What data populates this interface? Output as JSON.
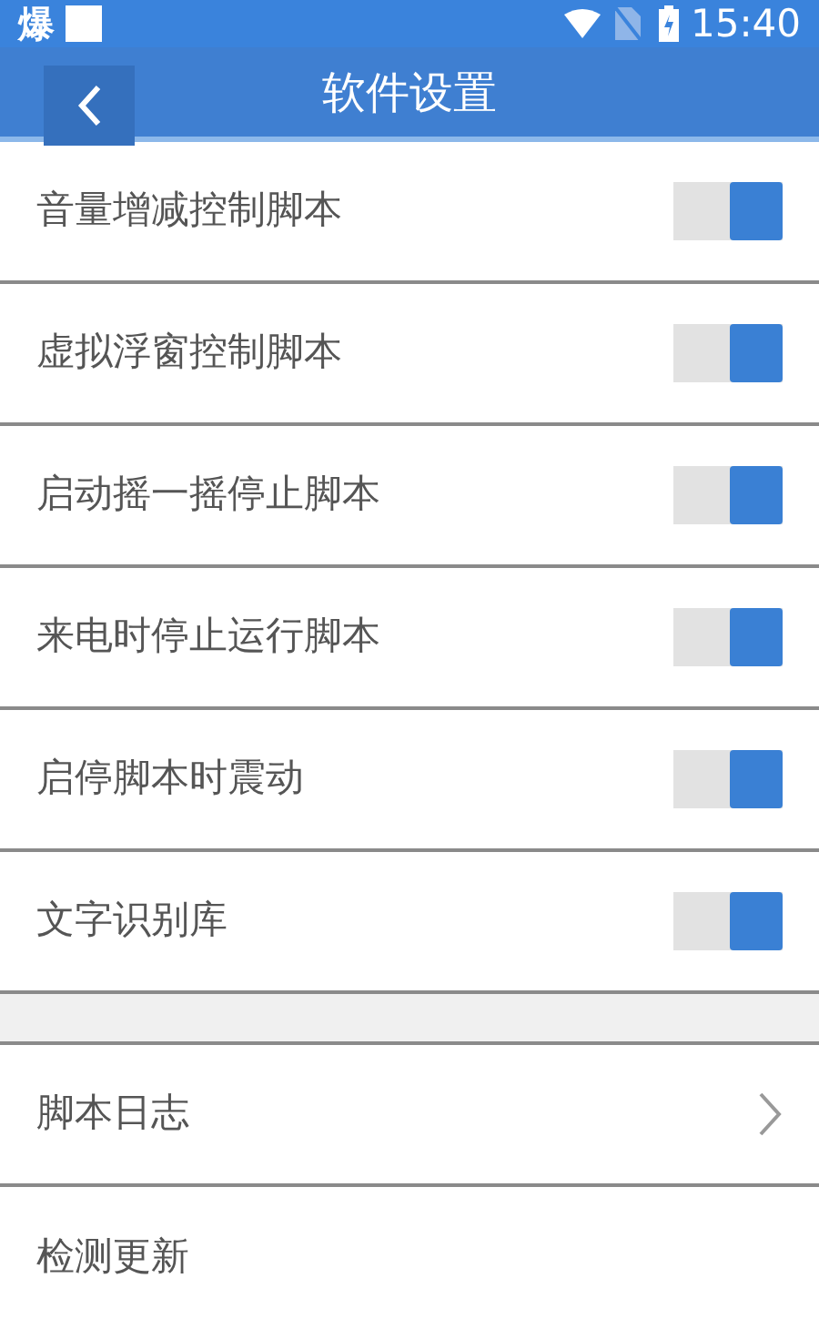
{
  "status_bar": {
    "app_glyph": "爆",
    "time": "15:40"
  },
  "header": {
    "title": "软件设置"
  },
  "toggles": [
    {
      "label": "音量增减控制脚本",
      "on": true
    },
    {
      "label": "虚拟浮窗控制脚本",
      "on": true
    },
    {
      "label": "启动摇一摇停止脚本",
      "on": true
    },
    {
      "label": "来电时停止运行脚本",
      "on": true
    },
    {
      "label": "启停脚本时震动",
      "on": true
    },
    {
      "label": "文字识别库",
      "on": true
    }
  ],
  "links": [
    {
      "label": "脚本日志",
      "kind": "chevron"
    },
    {
      "label": "检测更新",
      "kind": "plain"
    }
  ]
}
